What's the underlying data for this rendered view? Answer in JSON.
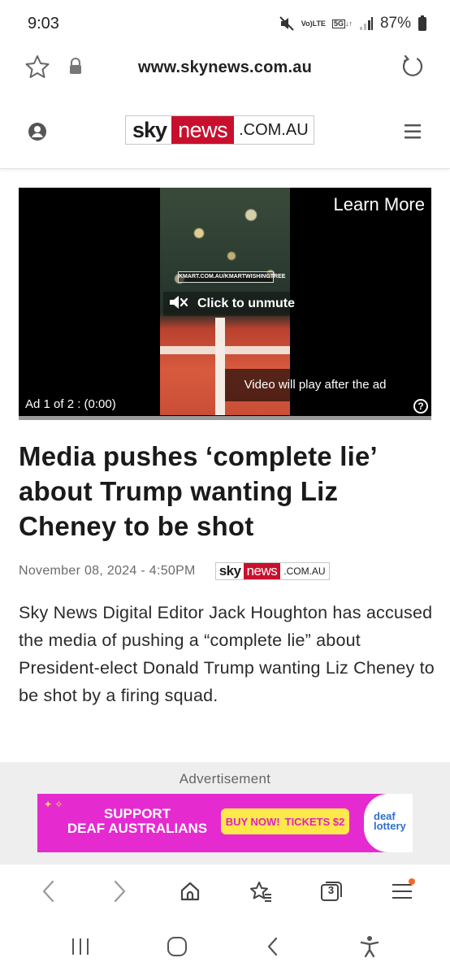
{
  "status_bar": {
    "time": "9:03",
    "network_top": "Vo)",
    "network_bottom": "LTE",
    "gen_top": "5G",
    "battery_percent": "87%",
    "icons": [
      "mute-icon",
      "signal-icon",
      "battery-icon"
    ]
  },
  "browser": {
    "url": "www.skynews.com.au",
    "icons": [
      "star-icon",
      "lock-icon",
      "reload-icon"
    ]
  },
  "site_header": {
    "logo": {
      "sky": "sky",
      "news": "news",
      "domain": ".COM.AU"
    },
    "brand_color": "#c8102e",
    "icons": [
      "user-icon",
      "hamburger-menu-icon"
    ]
  },
  "video_ad": {
    "learn_more": "Learn More",
    "thumbnail_caption": "KMART.COM.AU/KMARTWISHINGTREE",
    "unmute_label": "Click to unmute",
    "play_after_label": "Video will play after the ad",
    "ad_counter": "Ad 1 of 2 : (0:00)",
    "help_label": "?"
  },
  "article": {
    "headline": "Media pushes ‘complete lie’ about Trump wanting Liz Cheney to be shot",
    "date": "November 08, 2024 - 4:50PM",
    "source_logo": {
      "sky": "sky",
      "news": "news",
      "domain": ".COM.AU"
    },
    "body": "Sky News Digital Editor Jack Houghton has accused the media of pushing a “complete lie” about President-elect Donald Trump wanting Liz Cheney to be shot by a firing squad."
  },
  "advertisement": {
    "label": "Advertisement",
    "support_line1": "SUPPORT",
    "support_line2": "DEAF AUSTRALIANS",
    "buy_now": "BUY NOW!",
    "tickets": "TICKETS $2",
    "brand_line1": "deaf",
    "brand_line2": "lottery",
    "banner_color": "#e52ad0"
  },
  "toolbar": {
    "tab_count": "3",
    "icons": [
      "back-icon",
      "forward-icon",
      "home-icon",
      "bookmarks-icon",
      "tabs-icon",
      "menu-icon"
    ]
  },
  "navbar": {
    "icons": [
      "recents-icon",
      "home-circle-icon",
      "back-nav-icon",
      "accessibility-icon"
    ]
  }
}
